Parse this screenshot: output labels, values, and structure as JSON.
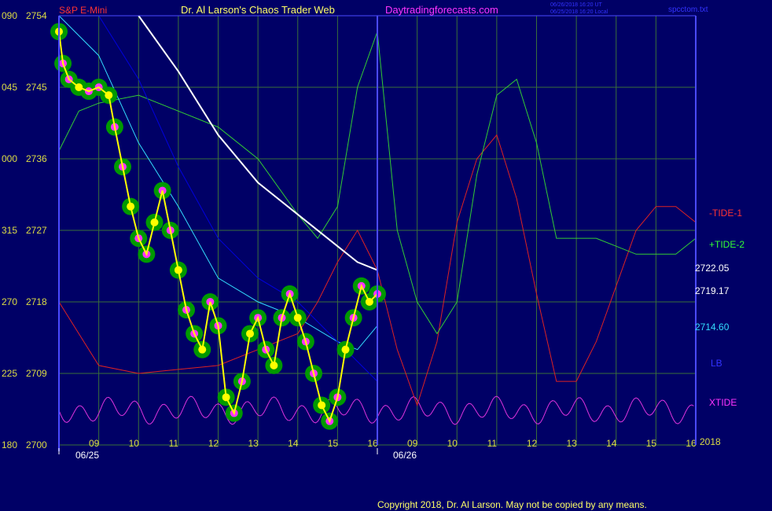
{
  "header": {
    "symbol": "S&P E-Mini",
    "title": "Dr. Al Larson's Chaos Trader Web",
    "site": "Daytradingforecasts.com",
    "stamp_line1": "06/26/2018 16:20 UT",
    "stamp_line2": "06/25/2018 16:20 Local",
    "file": "spcctom.txt"
  },
  "footer": {
    "copyright": "Copyright 2018, Dr. Al Larson. May not be copied by any means.",
    "year": "2018"
  },
  "colors": {
    "background": "#000066",
    "grid": "#3a6f3a",
    "axis": "#4a4aff",
    "price": "#ffff00",
    "price_dots": "#ff33ff",
    "halo": "#009900",
    "ma_white": "#ffffff",
    "ma_cyan": "#33ddff",
    "lb": "#0000dd",
    "tide1": "#dd2222",
    "tide2": "#33cc33",
    "xtide": "#dd33dd",
    "date_text": "#ffffff",
    "left_text": "#dddd44"
  },
  "chart_data": {
    "type": "line",
    "y_axis": {
      "ticks": [
        {
          "left": "090",
          "price": 2754
        },
        {
          "left": "045",
          "price": 2745
        },
        {
          "left": "000",
          "price": 2736
        },
        {
          "left": "315",
          "price": 2727
        },
        {
          "left": "270",
          "price": 2718
        },
        {
          "left": "225",
          "price": 2709
        },
        {
          "left": "180",
          "price": 2700
        }
      ],
      "range": [
        2700,
        2754
      ]
    },
    "x_axis": {
      "hour_ticks": [
        "09",
        "10",
        "11",
        "12",
        "13",
        "14",
        "15",
        "16",
        "09",
        "10",
        "11",
        "12",
        "13",
        "14",
        "15",
        "16"
      ],
      "dates": [
        "06/25",
        "06/26"
      ]
    },
    "right_labels": {
      "tide1": "-TIDE-1",
      "tide2": "+TIDE-2",
      "val1": "2722.05",
      "val2": "2719.17",
      "val3": "2714.60",
      "lb": "LB",
      "xtide": "XTIDE"
    },
    "series": [
      {
        "name": "price",
        "x": [
          0,
          0.1,
          0.25,
          0.5,
          0.75,
          1,
          1.25,
          1.4,
          1.6,
          1.8,
          2,
          2.2,
          2.4,
          2.6,
          2.8,
          3,
          3.2,
          3.4,
          3.6,
          3.8,
          4,
          4.2,
          4.4,
          4.6,
          4.8,
          5,
          5.2,
          5.4,
          5.6,
          5.8,
          6,
          6.2,
          6.4,
          6.6,
          6.8,
          7,
          7.2,
          7.4,
          7.6,
          7.8,
          8
        ],
        "y": [
          2752,
          2748,
          2746,
          2745,
          2744.5,
          2745,
          2744,
          2740,
          2735,
          2730,
          2726,
          2724,
          2728,
          2732,
          2727,
          2722,
          2717,
          2714,
          2712,
          2718,
          2715,
          2706,
          2704,
          2708,
          2714,
          2716,
          2712,
          2710,
          2716,
          2719,
          2716,
          2713,
          2709,
          2705,
          2703,
          2706,
          2712,
          2716,
          2720,
          2718,
          2719
        ]
      },
      {
        "name": "-TIDE-1",
        "x": [
          0,
          1,
          2,
          3,
          4,
          5,
          6,
          6.5,
          7,
          7.5,
          8,
          8.5,
          9,
          9.5,
          10,
          10.5,
          11,
          11.5,
          12,
          12.5,
          13,
          13.5,
          14,
          14.5,
          15,
          15.5,
          16
        ],
        "y": [
          2718,
          2710,
          2709,
          2709.5,
          2710,
          2712,
          2714,
          2718,
          2723,
          2727,
          2722,
          2712,
          2705,
          2713,
          2728,
          2736,
          2739,
          2731,
          2719,
          2708,
          2708,
          2713,
          2720,
          2727,
          2730,
          2730,
          2728
        ]
      },
      {
        "name": "+TIDE-2",
        "x": [
          0,
          0.5,
          1,
          2,
          3,
          4,
          5,
          6,
          6.5,
          7,
          7.5,
          8,
          8.5,
          9,
          9.5,
          10,
          10.5,
          11,
          11.5,
          12,
          12.5,
          13,
          13.5,
          14,
          14.5,
          15,
          15.5,
          16
        ],
        "y": [
          2737,
          2742,
          2743,
          2744,
          2742,
          2740,
          2736,
          2729,
          2726,
          2730,
          2745,
          2752,
          2727,
          2718,
          2714,
          2718,
          2734,
          2744,
          2746,
          2738,
          2726,
          2726,
          2726,
          2725,
          2724,
          2724,
          2724,
          2726
        ]
      },
      {
        "name": "white",
        "x": [
          2,
          3,
          4,
          5,
          6,
          7,
          7.5,
          8
        ],
        "y": [
          2754,
          2747,
          2739,
          2733,
          2729,
          2725,
          2723,
          2722
        ]
      },
      {
        "name": "cyan",
        "x": [
          0,
          1,
          2,
          3,
          4,
          5,
          6,
          7,
          7.5,
          8
        ],
        "y": [
          2754,
          2749,
          2738,
          2730,
          2721,
          2718,
          2716,
          2713,
          2712,
          2715
        ]
      },
      {
        "name": "LB",
        "x": [
          1,
          2,
          3,
          4,
          5,
          6,
          7,
          8
        ],
        "y": [
          2754,
          2746,
          2735,
          2726,
          2721,
          2718,
          2713,
          2708
        ]
      }
    ]
  }
}
